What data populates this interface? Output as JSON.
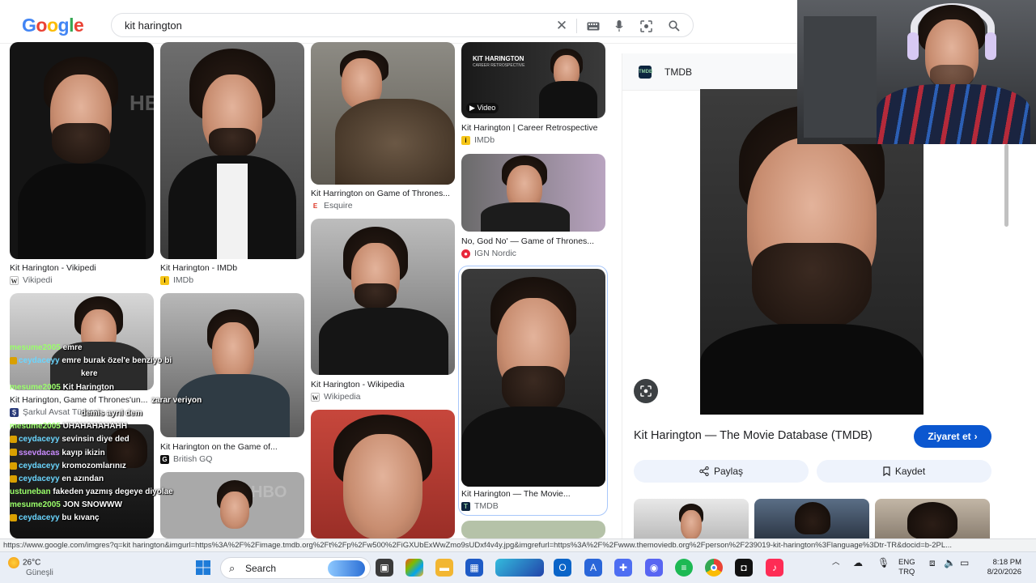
{
  "search": {
    "query": "kit harington"
  },
  "logo": [
    "G",
    "o",
    "o",
    "g",
    "l",
    "e"
  ],
  "results": [
    {
      "title": "Kit Harington - Vikipedi",
      "source": "Vikipedi",
      "fav": "W"
    },
    {
      "title": "Kit Harington - IMDb",
      "source": "IMDb",
      "fav": "IMDb"
    },
    {
      "title": "Kit Harrington on Game of Thrones...",
      "source": "Esquire",
      "fav": "E"
    },
    {
      "title": "Kit Harington | Career Retrospective",
      "source": "IMDb",
      "fav": "IMDb",
      "overlay": "KIT HARINGTON",
      "overlay_sub": "CAREER RETROSPECTIVE",
      "badge": "Video"
    },
    {
      "title": "No, God No' — Game of Thrones...",
      "source": "IGN Nordic",
      "fav": "ign"
    },
    {
      "title": "Kit Harington - Wikipedia",
      "source": "Wikipedia",
      "fav": "W"
    },
    {
      "title": "Kit Harington — The Movie...",
      "source": "TMDB",
      "fav": "TMDB"
    },
    {
      "title": "Kit Harington, Game of Thrones'un...",
      "source": "Şarkul Avsat Türkçe",
      "fav": "ŞA"
    },
    {
      "title": "Kit Harington on the Game of...",
      "source": "British GQ",
      "fav": "GQ"
    },
    {
      "overlay": "HBO"
    }
  ],
  "panel": {
    "source": "TMDB",
    "title": "Kit Harington — The Movie Database (TMDB)",
    "visit": "Ziyaret et",
    "share": "Paylaş",
    "save": "Kaydet"
  },
  "chat": [
    {
      "user": "mesume2005",
      "text": "emre"
    },
    {
      "user": "ceydaceyy",
      "text": "emre burak özel'e benziyo bi"
    },
    {
      "user": "",
      "text": "kere"
    },
    {
      "user": "mesume2005",
      "text": "Kit Harington"
    },
    {
      "user": "",
      "text": "zarar veriyon"
    },
    {
      "user": "",
      "text": "demis ayrıl dem"
    },
    {
      "user": "mesume2005",
      "text": "UHAHAHAHAHH"
    },
    {
      "user": "ceydaceyy",
      "text": "sevinsin diye ded"
    },
    {
      "user": "ssevdacas",
      "text": "kayıp ikizin"
    },
    {
      "user": "ceydaceyy",
      "text": "kromozomlarınız"
    },
    {
      "user": "ceydaceyy",
      "text": "en azından"
    },
    {
      "user": "ustuneban",
      "text": "fakeden yazmış degeye diyolae"
    },
    {
      "user": "mesume2005",
      "text": "JON SNOWWW"
    },
    {
      "user": "ceydaceyy",
      "text": "bu kıvanç"
    }
  ],
  "status_url": "https://www.google.com/imgres?q=kit harington&imgurl=https%3A%2F%2Fimage.tmdb.org%2Ft%2Fp%2Fw500%2FiGXUbExWwZmo9sUDxf4v4y.jpg&imgrefurl=https%3A%2F%2Fwww.themoviedb.org%2Fperson%2F239019-kit-harington%3Flanguage%3Dtr-TR&docid=b-2PL...",
  "taskbar": {
    "weather_temp": "26°C",
    "weather_loc": "Güneşli",
    "search": "Search",
    "lang": "ENG",
    "region": "TRQ",
    "time": "8:18 PM",
    "date": "8/20/2026"
  },
  "colors": {
    "accent": "#0b57d0",
    "chat_user": "#9aff6a"
  }
}
